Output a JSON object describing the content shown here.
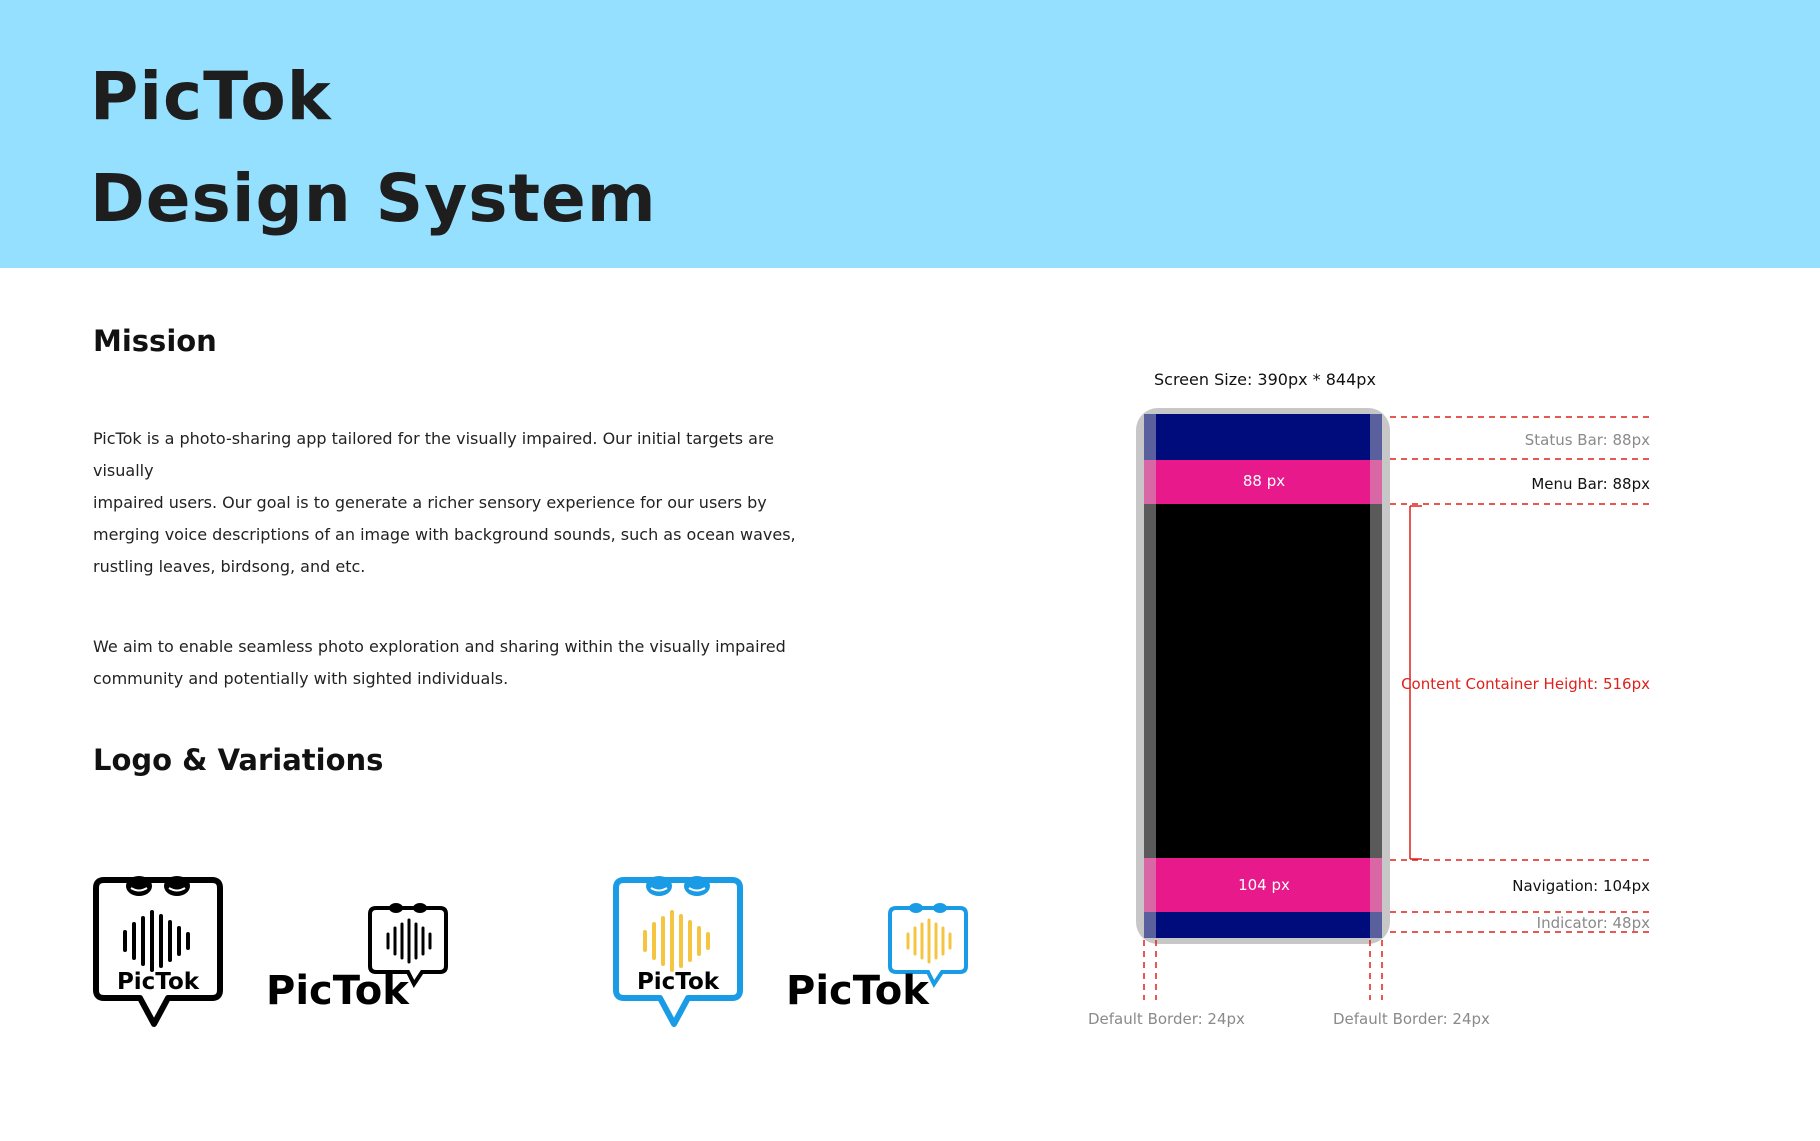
{
  "header": {
    "title_line1": "PicTok",
    "title_line2": "Design System",
    "background": "#95e0ff"
  },
  "mission": {
    "heading": "Mission",
    "paragraph1_lines": [
      "PicTok is a photo-sharing app tailored for the visually impaired. Our initial targets are visually",
      "impaired users. Our goal is to generate a richer sensory experience for our users by",
      "merging voice descriptions of an image with background sounds, such as ocean waves,",
      "rustling leaves, birdsong, and etc."
    ],
    "paragraph2_lines": [
      "We aim to enable seamless photo exploration and sharing within the visually impaired",
      "community and potentially with sighted individuals."
    ]
  },
  "logos": {
    "heading": "Logo & Variations",
    "wordmark": "PicTok",
    "colors": {
      "mono": "#000000",
      "blue": "#1a9be6",
      "yellow": "#f5c542"
    }
  },
  "spec": {
    "screen_size": "Screen Size: 390px * 844px",
    "status_bar": "Status Bar: 88px",
    "menu_bar": "Menu Bar: 88px",
    "content_container": "Content Container Height: 516px",
    "navigation": "Navigation: 104px",
    "indicator": "Indicator: 48px",
    "menu_inner": "88 px",
    "nav_inner": "104 px",
    "border_left": "Default Border: 24px",
    "border_right": "Default Border: 24px",
    "colors": {
      "navy": "#000c7c",
      "magenta": "#e8198b",
      "frame": "#c7c7c7",
      "dashed": "#e0201a"
    }
  }
}
